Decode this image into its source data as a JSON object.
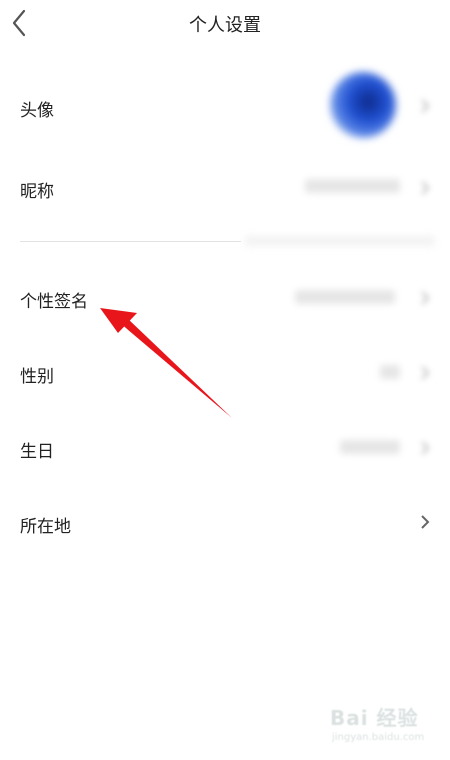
{
  "header": {
    "title": "个人设置",
    "back_icon": "chevron-left-icon"
  },
  "rows": [
    {
      "label": "头像",
      "kind": "avatar"
    },
    {
      "label": "昵称",
      "kind": "blurred-value"
    },
    {
      "label": "个性签名",
      "kind": "blurred-value"
    },
    {
      "label": "性别",
      "kind": "blurred-value"
    },
    {
      "label": "生日",
      "kind": "blurred-value"
    },
    {
      "label": "所在地",
      "kind": "chevron",
      "chevron_icon": "chevron-right-icon"
    }
  ],
  "annotation": {
    "color": "#e8151b",
    "icon": "red-arrow"
  },
  "watermark": {
    "line1": "Bai 经验",
    "line2": "jingyan.baidu.com"
  }
}
